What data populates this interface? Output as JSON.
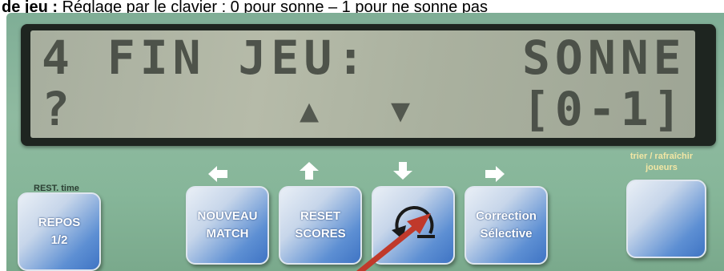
{
  "caption": {
    "bold_text": "de jeu :",
    "text": " Réglage par le clavier : 0 pour sonne – 1 pour ne sonne pas"
  },
  "lcd": {
    "line1_left": "4 FIN JEU:",
    "line1_right": "SONNE",
    "line2_left": "?",
    "line2_right": "[0-1]"
  },
  "labels": {
    "rest_time": "REST. time",
    "right_top": "trier / rafraîchir joueurs"
  },
  "buttons": {
    "repos": {
      "line1": "REPOS",
      "line2": "1/2"
    },
    "nouveau_match": {
      "line1": "NOUVEAU",
      "line2": "MATCH"
    },
    "reset_scores": {
      "line1": "RESET",
      "line2": "SCORES"
    },
    "correction": {
      "line1": "Correction",
      "line2": "Sélective"
    }
  },
  "colors": {
    "panel": "#8fbaa0",
    "lcd_background": "#b0b6a4",
    "button_blue": "#5d8fd3",
    "pointer_red": "#c0392b"
  }
}
